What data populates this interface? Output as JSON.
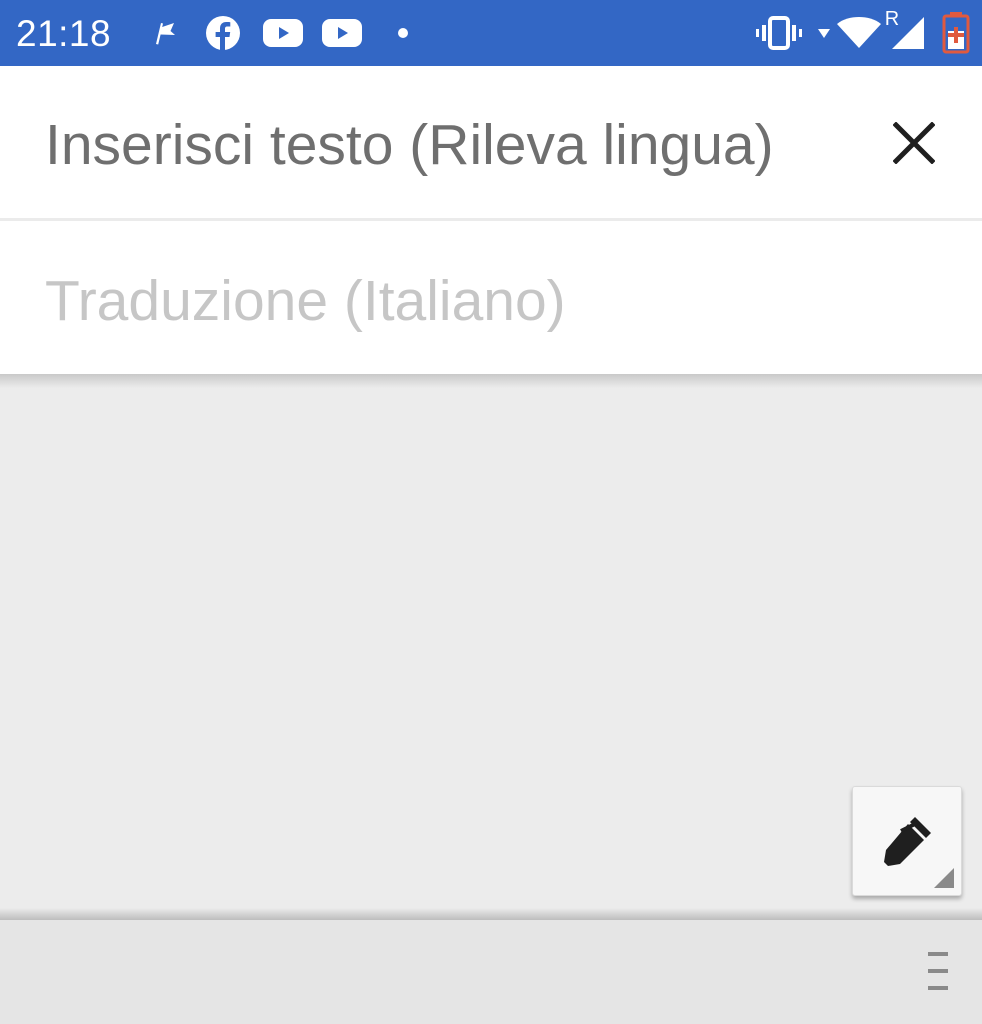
{
  "status_bar": {
    "time": "21:18",
    "roaming_indicator": "R",
    "colors": {
      "background": "#3367c5",
      "battery_charging": "#e05a3f"
    },
    "left_icons": [
      "flag-icon",
      "facebook-icon",
      "youtube-icon",
      "youtube-icon",
      "dot-icon"
    ],
    "right_icons": [
      "vibrate-icon",
      "data-arrow-icon",
      "wifi-icon",
      "cell-signal-icon",
      "battery-charging-icon"
    ]
  },
  "input": {
    "placeholder": "Inserisci testo (Rileva lingua)",
    "clear_icon": "close-icon"
  },
  "output": {
    "placeholder": "Traduzione (Italiano)"
  },
  "tools": {
    "handwrite_icon": "pen-icon"
  },
  "bottom_bar": {
    "menu_icon": "drag-handle-icon"
  }
}
